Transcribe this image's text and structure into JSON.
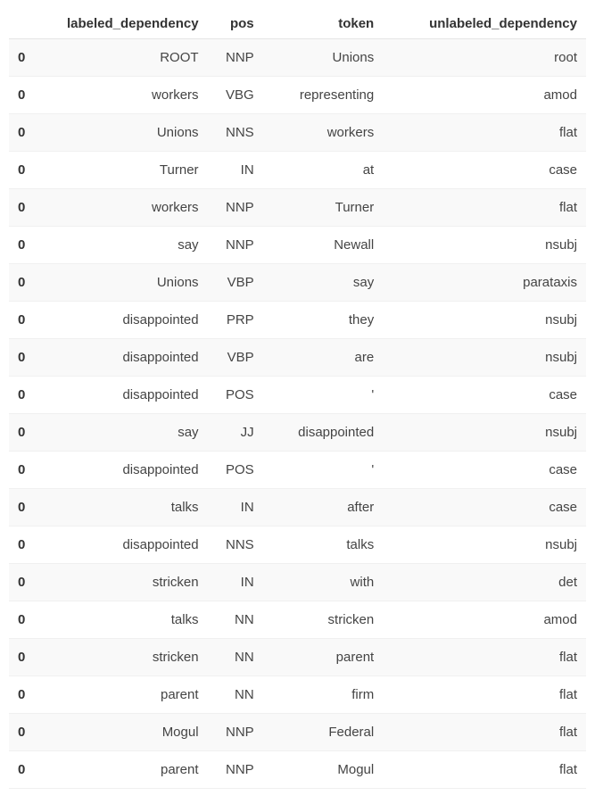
{
  "table": {
    "headers": {
      "index": "",
      "labeled_dependency": "labeled_dependency",
      "pos": "pos",
      "token": "token",
      "unlabeled_dependency": "unlabeled_dependency"
    },
    "rows": [
      {
        "index": "0",
        "labeled_dependency": "ROOT",
        "pos": "NNP",
        "token": "Unions",
        "unlabeled_dependency": "root"
      },
      {
        "index": "0",
        "labeled_dependency": "workers",
        "pos": "VBG",
        "token": "representing",
        "unlabeled_dependency": "amod"
      },
      {
        "index": "0",
        "labeled_dependency": "Unions",
        "pos": "NNS",
        "token": "workers",
        "unlabeled_dependency": "flat"
      },
      {
        "index": "0",
        "labeled_dependency": "Turner",
        "pos": "IN",
        "token": "at",
        "unlabeled_dependency": "case"
      },
      {
        "index": "0",
        "labeled_dependency": "workers",
        "pos": "NNP",
        "token": "Turner",
        "unlabeled_dependency": "flat"
      },
      {
        "index": "0",
        "labeled_dependency": "say",
        "pos": "NNP",
        "token": "Newall",
        "unlabeled_dependency": "nsubj"
      },
      {
        "index": "0",
        "labeled_dependency": "Unions",
        "pos": "VBP",
        "token": "say",
        "unlabeled_dependency": "parataxis"
      },
      {
        "index": "0",
        "labeled_dependency": "disappointed",
        "pos": "PRP",
        "token": "they",
        "unlabeled_dependency": "nsubj"
      },
      {
        "index": "0",
        "labeled_dependency": "disappointed",
        "pos": "VBP",
        "token": "are",
        "unlabeled_dependency": "nsubj"
      },
      {
        "index": "0",
        "labeled_dependency": "disappointed",
        "pos": "POS",
        "token": "'",
        "unlabeled_dependency": "case"
      },
      {
        "index": "0",
        "labeled_dependency": "say",
        "pos": "JJ",
        "token": "disappointed",
        "unlabeled_dependency": "nsubj"
      },
      {
        "index": "0",
        "labeled_dependency": "disappointed",
        "pos": "POS",
        "token": "'",
        "unlabeled_dependency": "case"
      },
      {
        "index": "0",
        "labeled_dependency": "talks",
        "pos": "IN",
        "token": "after",
        "unlabeled_dependency": "case"
      },
      {
        "index": "0",
        "labeled_dependency": "disappointed",
        "pos": "NNS",
        "token": "talks",
        "unlabeled_dependency": "nsubj"
      },
      {
        "index": "0",
        "labeled_dependency": "stricken",
        "pos": "IN",
        "token": "with",
        "unlabeled_dependency": "det"
      },
      {
        "index": "0",
        "labeled_dependency": "talks",
        "pos": "NN",
        "token": "stricken",
        "unlabeled_dependency": "amod"
      },
      {
        "index": "0",
        "labeled_dependency": "stricken",
        "pos": "NN",
        "token": "parent",
        "unlabeled_dependency": "flat"
      },
      {
        "index": "0",
        "labeled_dependency": "parent",
        "pos": "NN",
        "token": "firm",
        "unlabeled_dependency": "flat"
      },
      {
        "index": "0",
        "labeled_dependency": "Mogul",
        "pos": "NNP",
        "token": "Federal",
        "unlabeled_dependency": "flat"
      },
      {
        "index": "0",
        "labeled_dependency": "parent",
        "pos": "NNP",
        "token": "Mogul",
        "unlabeled_dependency": "flat"
      }
    ]
  }
}
